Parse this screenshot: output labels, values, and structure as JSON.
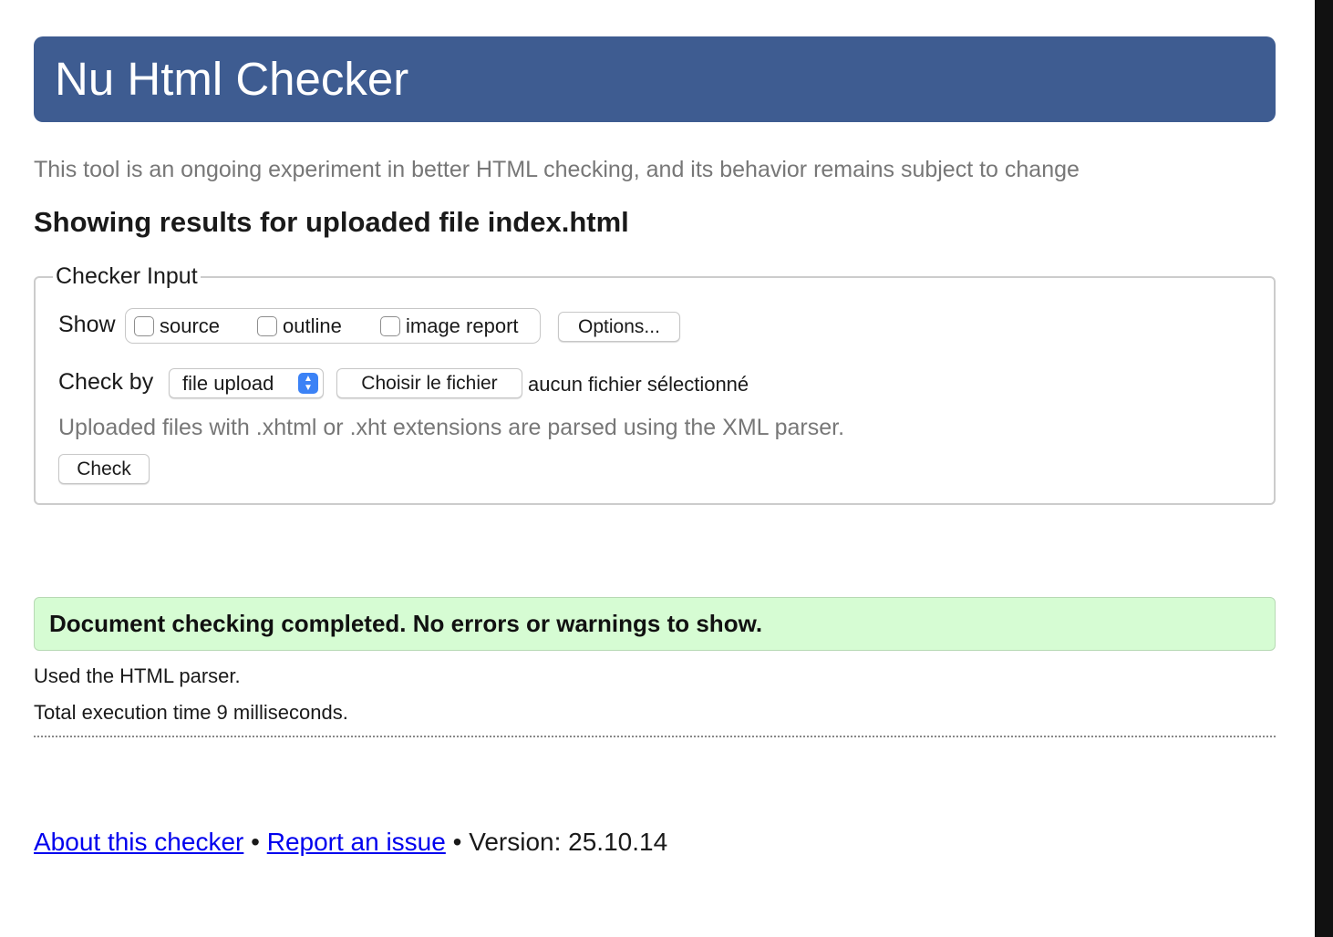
{
  "header": {
    "title": "Nu Html Checker"
  },
  "tagline": "This tool is an ongoing experiment in better HTML checking, and its behavior remains subject to change",
  "results_heading": "Showing results for uploaded file index.html",
  "checker_input": {
    "legend": "Checker Input",
    "show_label": "Show",
    "show_options": [
      {
        "label": "source",
        "checked": false
      },
      {
        "label": "outline",
        "checked": false
      },
      {
        "label": "image report",
        "checked": false
      }
    ],
    "options_button": "Options...",
    "check_by_label": "Check by",
    "check_by_value": "file upload",
    "file_button": "Choisir le fichier",
    "file_status": "aucun fichier sélectionné",
    "hint": "Uploaded files with .xhtml or .xht extensions are parsed using the XML parser.",
    "check_button": "Check"
  },
  "result": {
    "success_message": "Document checking completed. No errors or warnings to show.",
    "parser_info": "Used the HTML parser.",
    "execution_time": "Total execution time 9 milliseconds."
  },
  "footer": {
    "about_link": "About this checker",
    "separator": "•",
    "report_link": "Report an issue",
    "version": "Version: 25.10.14"
  },
  "colors": {
    "header_bg": "#3e5c91",
    "success_bg": "#d6fcd3",
    "link": "#0000ee"
  }
}
